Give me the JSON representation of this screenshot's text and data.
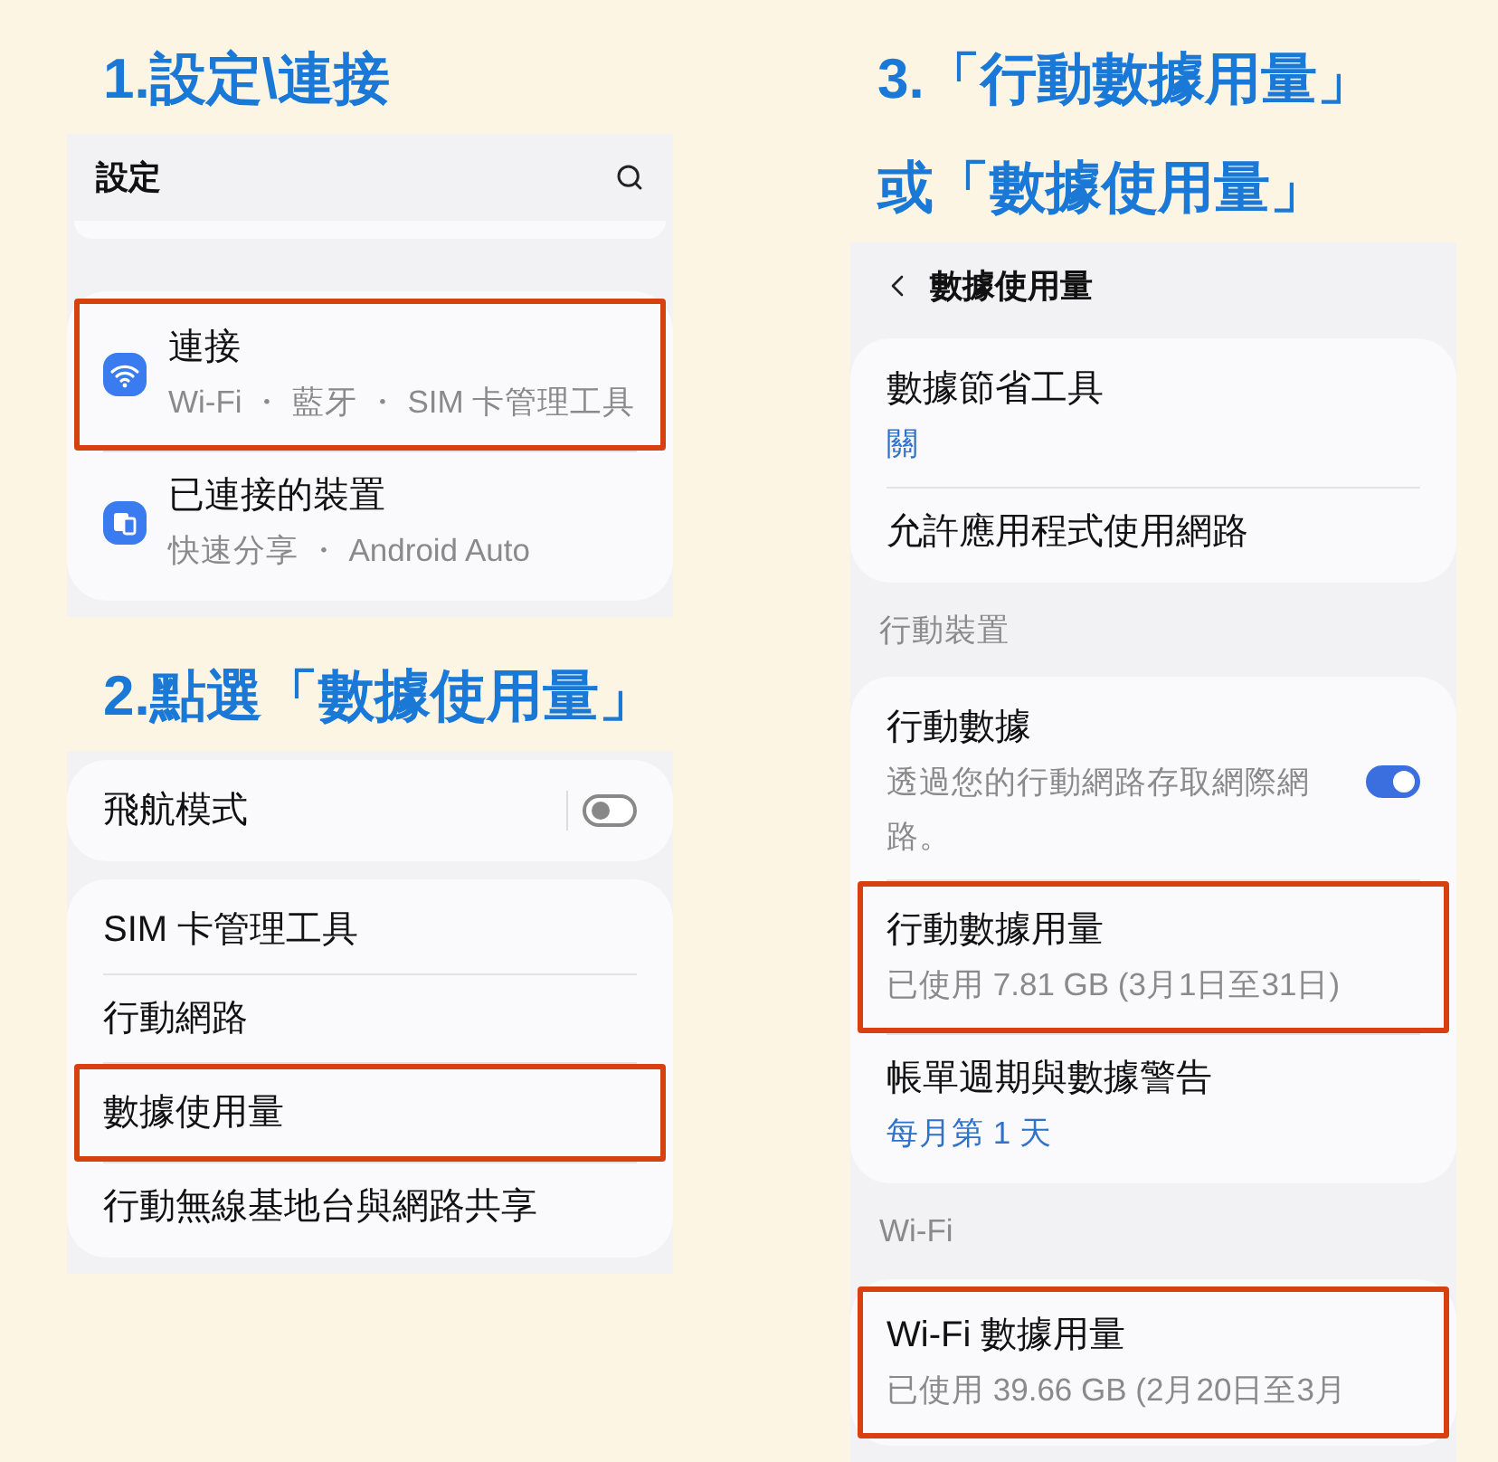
{
  "columns": [
    {
      "steps": [
        {
          "heading": [
            "1.設定\\連接"
          ],
          "screen": {
            "header": {
              "title": "設定",
              "kind": "main"
            },
            "blocks": [
              {
                "kind": "stub"
              },
              {
                "kind": "icon_card",
                "rows": [
                  {
                    "title": "連接",
                    "summary": "Wi-Fi ・ 藍牙 ・ SIM 卡管理工具",
                    "highlighted": true
                  },
                  {
                    "title": "已連接的裝置",
                    "summary": "快速分享 ・ Android Auto",
                    "highlighted": false
                  }
                ]
              }
            ]
          }
        },
        {
          "heading": [
            "2.點選「數據使用量」"
          ],
          "screen": {
            "blocks": [
              {
                "kind": "card",
                "rows": [
                  {
                    "title": "飛航模式",
                    "toggle": {
                      "on": false
                    },
                    "highlighted": false
                  }
                ]
              },
              {
                "kind": "card",
                "rows": [
                  {
                    "title": "SIM 卡管理工具",
                    "highlighted": false
                  },
                  {
                    "title": "行動網路",
                    "highlighted": false
                  },
                  {
                    "title": "數據使用量",
                    "highlighted": true
                  },
                  {
                    "title": "行動無線基地台與網路共享",
                    "highlighted": false
                  }
                ]
              }
            ]
          }
        }
      ]
    },
    {
      "steps": [
        {
          "heading": [
            "3.「行動數據用量」",
            "或「數據使用量」"
          ],
          "screen": {
            "header": {
              "title": "數據使用量",
              "kind": "sub"
            },
            "blocks": [
              {
                "kind": "card",
                "rows": [
                  {
                    "title": "數據節省工具",
                    "value": "關",
                    "highlighted": false
                  },
                  {
                    "title": "允許應用程式使用網路",
                    "highlighted": false
                  }
                ]
              },
              {
                "kind": "section",
                "label": "行動裝置"
              },
              {
                "kind": "card",
                "rows": [
                  {
                    "title": "行動數據",
                    "summary": "透過您的行動網路存取網際網路。",
                    "toggle": {
                      "on": true
                    },
                    "highlighted": false
                  },
                  {
                    "title": "行動數據用量",
                    "summary": "已使用 7.81 GB (3月1日至31日)",
                    "highlighted": true
                  },
                  {
                    "title": "帳單週期與數據警告",
                    "value": "每月第 1 天",
                    "highlighted": false
                  }
                ]
              },
              {
                "kind": "section",
                "label": "Wi-Fi"
              },
              {
                "kind": "card",
                "rows": [
                  {
                    "title": "Wi-Fi 數據用量",
                    "summary": "已使用 39.66 GB (2月20日至3月",
                    "highlighted": true
                  }
                ]
              }
            ]
          }
        }
      ]
    }
  ]
}
